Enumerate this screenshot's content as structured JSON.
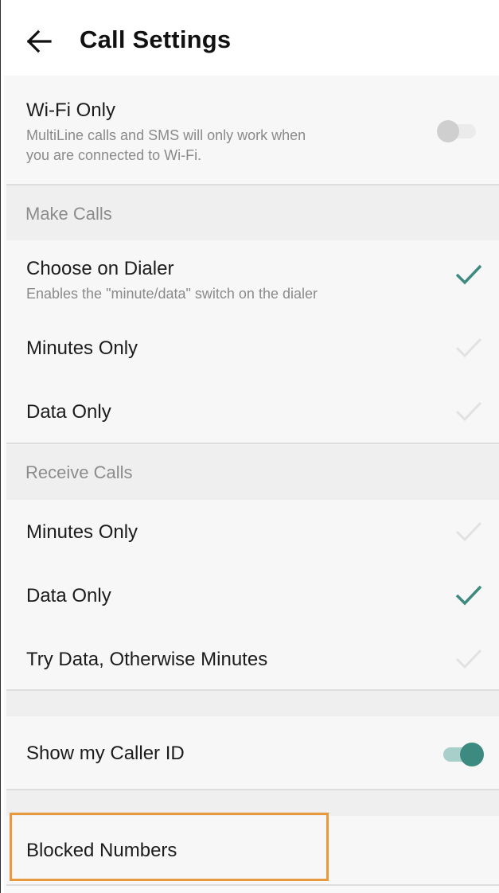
{
  "header": {
    "title": "Call Settings"
  },
  "wifi": {
    "label": "Wi-Fi Only",
    "description_line1": "MultiLine calls and SMS will only work when",
    "description_line2": "you are connected to Wi-Fi.",
    "enabled": false
  },
  "make_calls": {
    "header": "Make Calls",
    "options": [
      {
        "label": "Choose on Dialer",
        "description": "Enables the \"minute/data\" switch on the dialer",
        "selected": true
      },
      {
        "label": "Minutes Only",
        "selected": false
      },
      {
        "label": "Data Only",
        "selected": false
      }
    ]
  },
  "receive_calls": {
    "header": "Receive Calls",
    "options": [
      {
        "label": "Minutes Only",
        "selected": false
      },
      {
        "label": "Data Only",
        "selected": true
      },
      {
        "label": "Try Data, Otherwise Minutes",
        "selected": false
      }
    ]
  },
  "caller_id": {
    "label": "Show my Caller ID",
    "enabled": true
  },
  "blocked": {
    "label": "Blocked Numbers"
  },
  "colors": {
    "accent": "#3d8b80",
    "check_inactive": "#e2e2e2",
    "highlight": "#e8993e"
  }
}
